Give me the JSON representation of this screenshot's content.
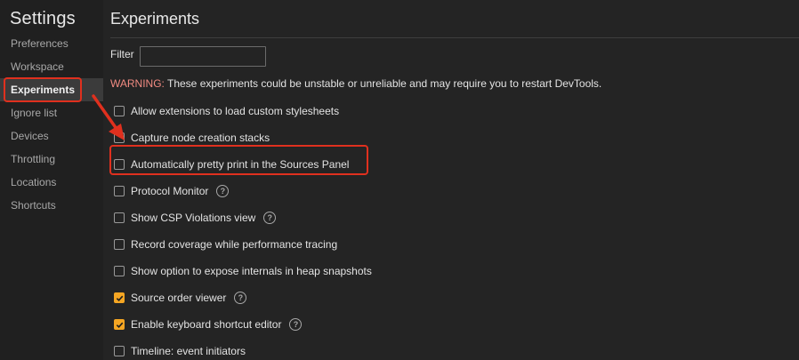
{
  "sidebar": {
    "title": "Settings",
    "items": [
      {
        "label": "Preferences"
      },
      {
        "label": "Workspace"
      },
      {
        "label": "Experiments"
      },
      {
        "label": "Ignore list"
      },
      {
        "label": "Devices"
      },
      {
        "label": "Throttling"
      },
      {
        "label": "Locations"
      },
      {
        "label": "Shortcuts"
      }
    ],
    "selected": "Experiments"
  },
  "main": {
    "title": "Experiments",
    "filter": {
      "label": "Filter",
      "value": "",
      "placeholder": ""
    },
    "warning": {
      "label": "WARNING:",
      "text": " These experiments could be unstable or unreliable and may require you to restart DevTools."
    },
    "experiments": [
      {
        "label": "Allow extensions to load custom stylesheets",
        "checked": false,
        "help": false
      },
      {
        "label": "Capture node creation stacks",
        "checked": false,
        "help": false
      },
      {
        "label": "Automatically pretty print in the Sources Panel",
        "checked": false,
        "help": false
      },
      {
        "label": "Protocol Monitor",
        "checked": false,
        "help": true
      },
      {
        "label": "Show CSP Violations view",
        "checked": false,
        "help": true
      },
      {
        "label": "Record coverage while performance tracing",
        "checked": false,
        "help": false
      },
      {
        "label": "Show option to expose internals in heap snapshots",
        "checked": false,
        "help": false
      },
      {
        "label": "Source order viewer",
        "checked": true,
        "help": true
      },
      {
        "label": "Enable keyboard shortcut editor",
        "checked": true,
        "help": true
      },
      {
        "label": "Timeline: event initiators",
        "checked": false,
        "help": false
      }
    ],
    "help_glyph": "?"
  },
  "colors": {
    "background": "#242424",
    "sidebar_background": "#202020",
    "selected_item_background": "#3b3b3b",
    "checked_accent": "#f5a623",
    "warning_label": "#f28b82",
    "annotation_red": "#e0301e"
  },
  "icons": {
    "help": "help-circle-icon",
    "check": "checkmark-icon",
    "annotation_arrow": "arrow-icon"
  }
}
